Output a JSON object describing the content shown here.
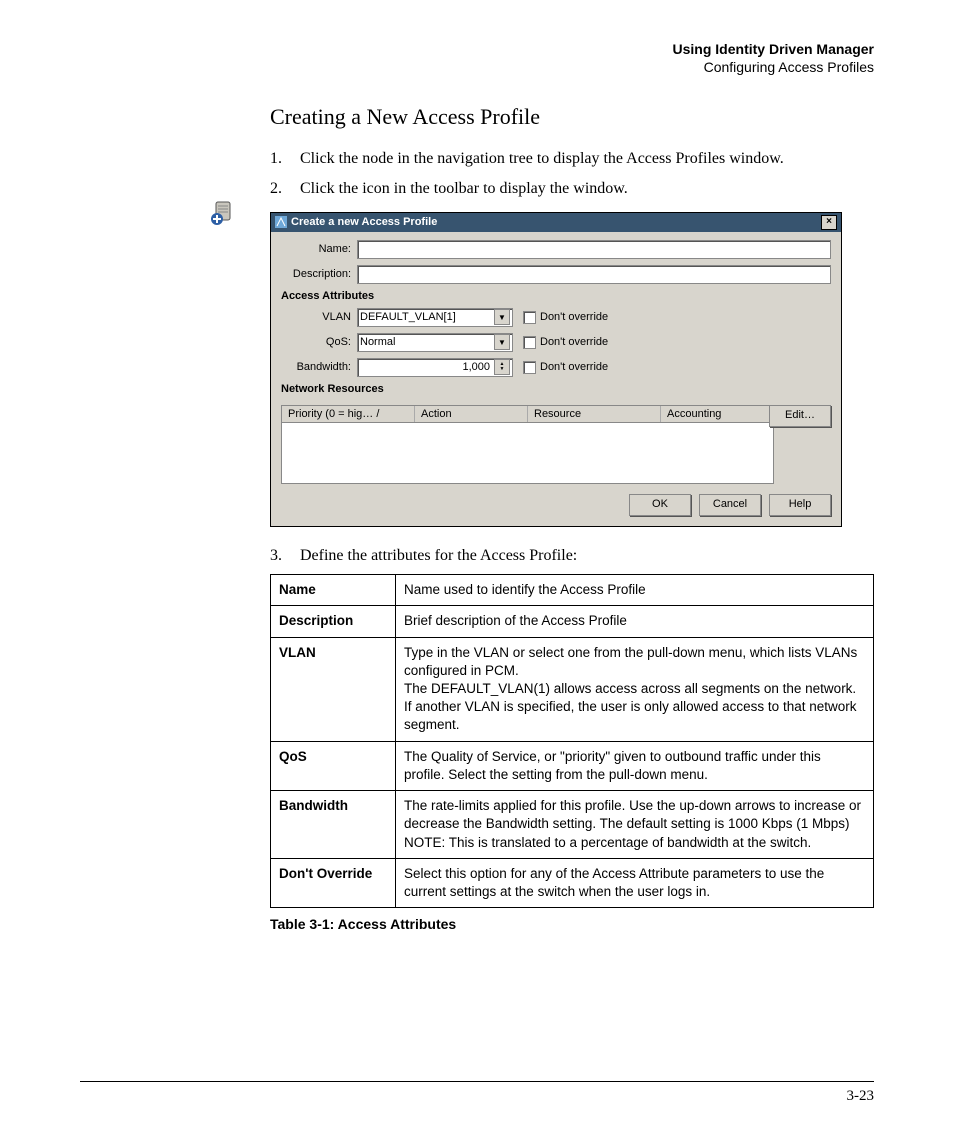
{
  "header": {
    "bold": "Using Identity Driven Manager",
    "sub": "Configuring Access Profiles"
  },
  "title": "Creating a New Access Profile",
  "steps": {
    "s1": "Click the                          node in the                                              navigation tree to display the Access Profiles window.",
    "s2": "Click the                                   icon in the toolbar to display the                                       window.",
    "s3": "Define the attributes for the Access Profile:"
  },
  "dialog": {
    "title": "Create a new Access Profile",
    "labels": {
      "name": "Name:",
      "desc": "Description:",
      "attrs": "Access Attributes",
      "vlan": "VLAN",
      "qos": "QoS:",
      "bw": "Bandwidth:",
      "netres": "Network Resources",
      "dont": "Don't override"
    },
    "values": {
      "vlan": "DEFAULT_VLAN[1]",
      "qos": "Normal",
      "bw": "1,000"
    },
    "cols": {
      "c1": "Priority (0 = hig…  /",
      "c2": "Action",
      "c3": "Resource",
      "c4": "Accounting"
    },
    "buttons": {
      "edit": "Edit…",
      "ok": "OK",
      "cancel": "Cancel",
      "help": "Help"
    }
  },
  "table": {
    "rows": [
      {
        "k": "Name",
        "v": "Name used to identify the Access Profile"
      },
      {
        "k": "Description",
        "v": "Brief description of the Access Profile"
      },
      {
        "k": "VLAN",
        "v": "Type in the VLAN or select one from the pull-down menu, which lists VLANs configured in PCM.\nThe DEFAULT_VLAN(1) allows access across all segments on the network. If another VLAN is specified, the user is only allowed access to that network segment."
      },
      {
        "k": "QoS",
        "v": "The Quality of Service, or \"priority\" given to outbound traffic under this profile. Select the setting from the pull-down menu."
      },
      {
        "k": "Bandwidth",
        "v": "The rate-limits applied for this profile. Use the up-down arrows to increase or decrease the Bandwidth setting. The default setting is 1000 Kbps (1 Mbps)\nNOTE: This is translated to a percentage of bandwidth at the switch."
      },
      {
        "k": "Don't Override",
        "v": "Select this option for any of the Access Attribute parameters to use the current settings at the switch when the user logs in."
      }
    ],
    "caption": "Table 3-1: Access Attributes"
  },
  "pagenum": "3-23"
}
